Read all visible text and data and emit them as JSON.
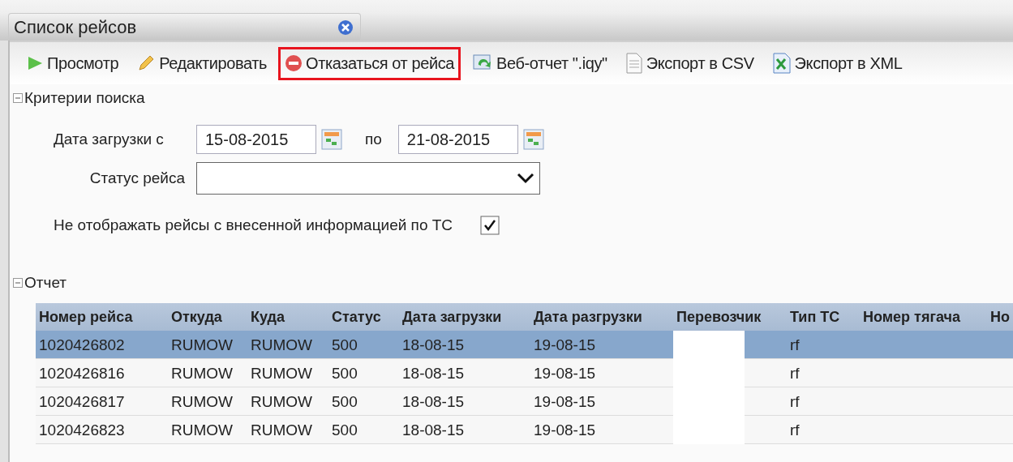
{
  "window": {
    "title": "Список рейсов"
  },
  "toolbar": [
    {
      "kind": "view",
      "label": "Просмотр",
      "highlighted": false
    },
    {
      "kind": "edit",
      "label": "Редактировать",
      "highlighted": false
    },
    {
      "kind": "cancel",
      "label": "Отказаться от рейса",
      "highlighted": true
    },
    {
      "kind": "web",
      "label": "Веб-отчет \".iqy\"",
      "highlighted": false
    },
    {
      "kind": "csv",
      "label": "Экспорт в CSV",
      "highlighted": false
    },
    {
      "kind": "xml",
      "label": "Экспорт в XML",
      "highlighted": false
    }
  ],
  "search": {
    "title": "Критерии поиска",
    "expanded": true,
    "date_label": "Дата загрузки с",
    "date_from": "15-08-2015",
    "to_label": "по",
    "date_to": "21-08-2015",
    "status_label": "Статус рейса",
    "checkbox_label": "Не отображать рейсы с внесенной информацией по ТС",
    "checked": true
  },
  "report": {
    "title": "Отчет",
    "expanded": true,
    "columns": [
      "Номер рейса",
      "Откуда",
      "Куда",
      "Статус",
      "Дата загрузки",
      "Дата разгрузки",
      "Перевозчик",
      "Тип ТС",
      "Номер тягача",
      "Но"
    ],
    "rows": [
      {
        "selected": true,
        "cells": [
          "1020426802",
          "RUMOW",
          "RUMOW",
          "500",
          "18-08-15",
          "19-08-15",
          "",
          "rf",
          "",
          ""
        ]
      },
      {
        "selected": false,
        "cells": [
          "1020426816",
          "RUMOW",
          "RUMOW",
          "500",
          "18-08-15",
          "19-08-15",
          "",
          "rf",
          "",
          ""
        ]
      },
      {
        "selected": false,
        "cells": [
          "1020426817",
          "RUMOW",
          "RUMOW",
          "500",
          "18-08-15",
          "19-08-15",
          "",
          "rf",
          "",
          ""
        ]
      },
      {
        "selected": false,
        "cells": [
          "1020426823",
          "RUMOW",
          "RUMOW",
          "500",
          "18-08-15",
          "19-08-15",
          "",
          "rf",
          "",
          ""
        ]
      }
    ]
  }
}
